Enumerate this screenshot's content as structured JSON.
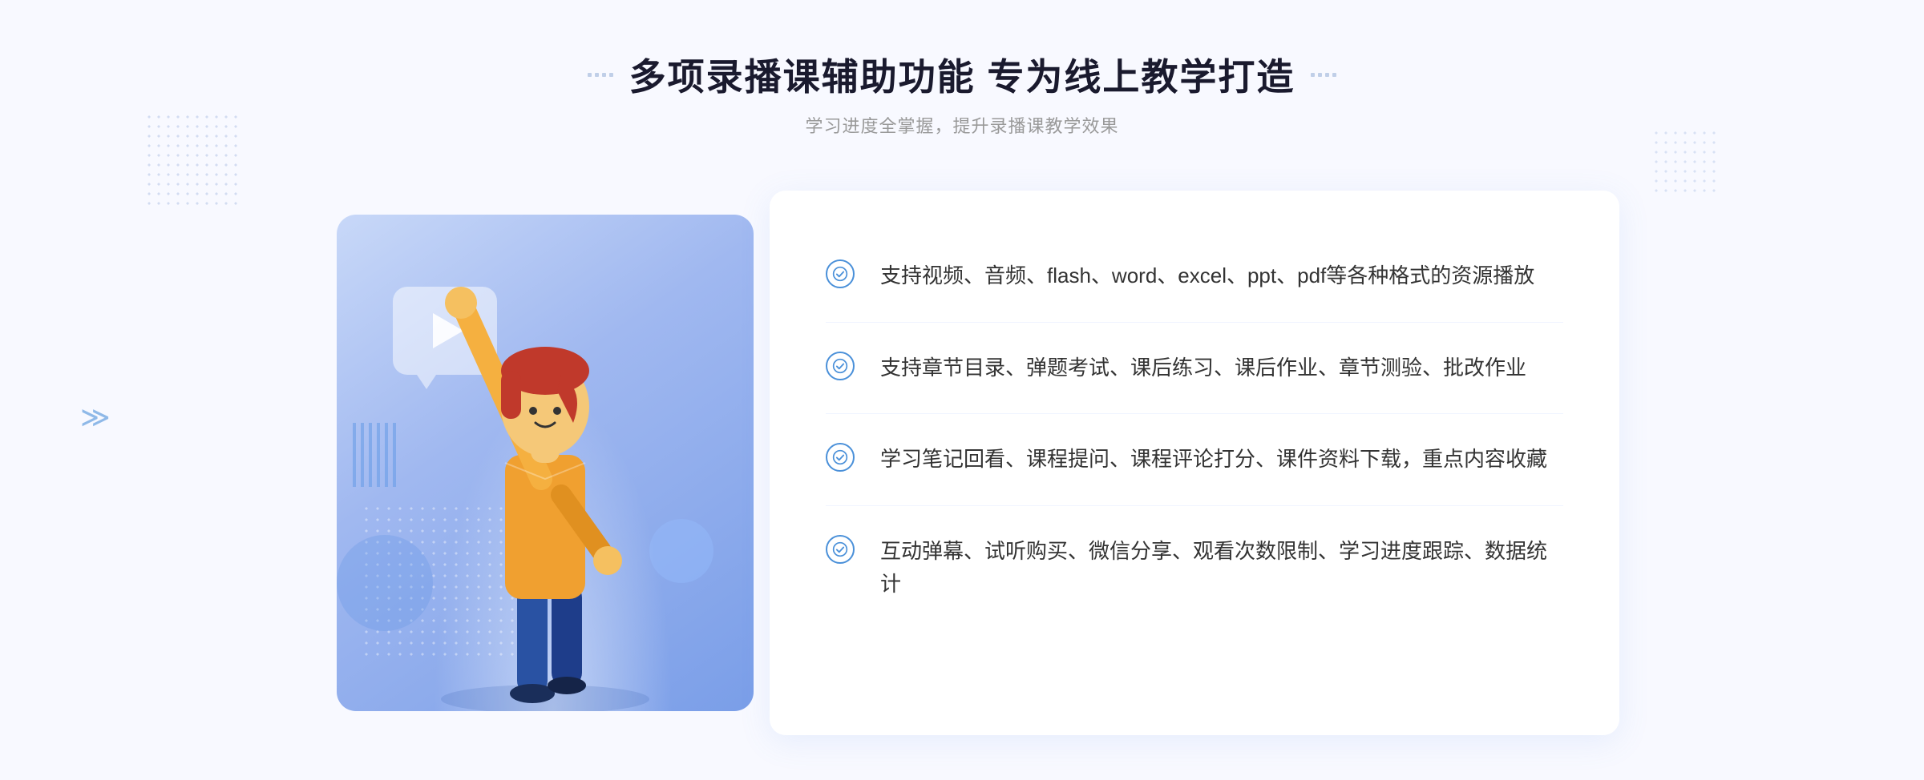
{
  "header": {
    "main_title": "多项录播课辅助功能 专为线上教学打造",
    "sub_title": "学习进度全掌握，提升录播课教学效果"
  },
  "features": [
    {
      "id": "feature-1",
      "text": "支持视频、音频、flash、word、excel、ppt、pdf等各种格式的资源播放"
    },
    {
      "id": "feature-2",
      "text": "支持章节目录、弹题考试、课后练习、课后作业、章节测验、批改作业"
    },
    {
      "id": "feature-3",
      "text": "学习笔记回看、课程提问、课程评论打分、课件资料下载，重点内容收藏"
    },
    {
      "id": "feature-4",
      "text": "互动弹幕、试听购买、微信分享、观看次数限制、学习进度跟踪、数据统计"
    }
  ],
  "colors": {
    "primary_blue": "#4a90d9",
    "light_blue": "#7ab0f0",
    "bg": "#f8f9ff",
    "text_dark": "#1a1a2e",
    "text_gray": "#999999",
    "text_body": "#333333"
  }
}
